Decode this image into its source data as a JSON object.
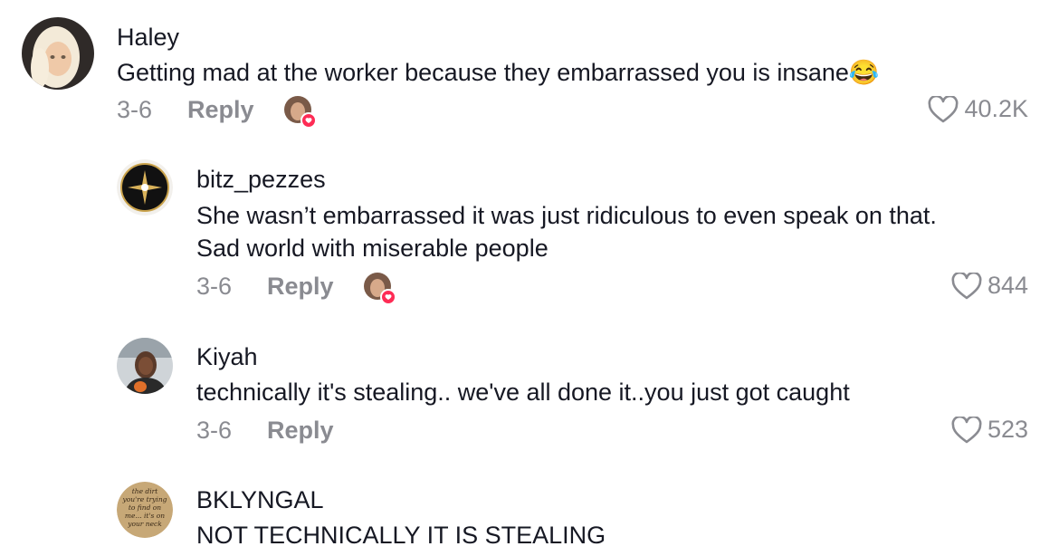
{
  "comments": [
    {
      "username": "Haley",
      "lines": [
        "Getting mad at the worker because they embarrassed you is insane😂"
      ],
      "date": "3-6",
      "reply_label": "Reply",
      "likes": "40.2K",
      "creator_liked": true
    },
    {
      "username": "bitz_pezzes",
      "lines": [
        "She wasn’t embarrassed it was just ridiculous to even speak on that.",
        "Sad world with miserable people"
      ],
      "date": "3-6",
      "reply_label": "Reply",
      "likes": "844",
      "creator_liked": true
    },
    {
      "username": "Kiyah",
      "lines": [
        "technically it's stealing.. we've all done it..you just got caught"
      ],
      "date": "3-6",
      "reply_label": "Reply",
      "likes": "523",
      "creator_liked": false
    },
    {
      "username": "BKLYNGAL",
      "lines": [
        "NOT TECHNICALLY IT IS STEALING"
      ],
      "avatar_text": [
        "the dirt",
        "you're trying",
        "to find on",
        "me... it's on",
        "your neck"
      ]
    }
  ],
  "colors": {
    "text": "#161823",
    "muted": "#8a8b91",
    "heart_badge": "#fe2c55"
  }
}
